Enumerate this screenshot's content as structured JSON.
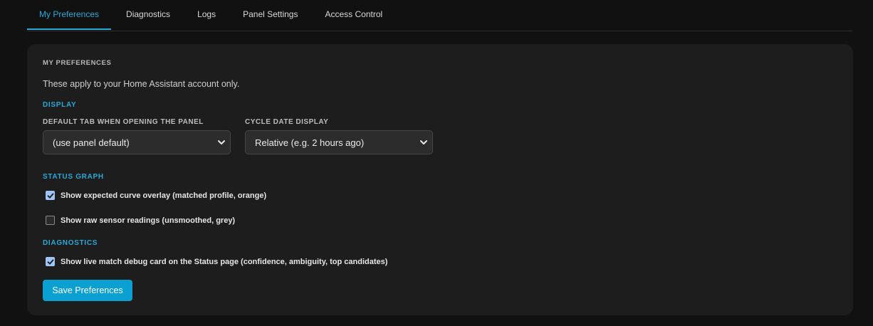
{
  "tabs": [
    {
      "label": "My Preferences",
      "active": true
    },
    {
      "label": "Diagnostics",
      "active": false
    },
    {
      "label": "Logs",
      "active": false
    },
    {
      "label": "Panel Settings",
      "active": false
    },
    {
      "label": "Access Control",
      "active": false
    }
  ],
  "card": {
    "title": "MY PREFERENCES",
    "intro": "These apply to your Home Assistant account only."
  },
  "display": {
    "heading": "DISPLAY",
    "default_tab": {
      "label": "DEFAULT TAB WHEN OPENING THE PANEL",
      "value": "(use panel default)"
    },
    "cycle_date": {
      "label": "CYCLE DATE DISPLAY",
      "value": "Relative (e.g. 2 hours ago)"
    }
  },
  "status_graph": {
    "heading": "STATUS GRAPH",
    "options": [
      {
        "label": "Show expected curve overlay (matched profile, orange)",
        "checked": true
      },
      {
        "label": "Show raw sensor readings (unsmoothed, grey)",
        "checked": false
      }
    ]
  },
  "diagnostics": {
    "heading": "DIAGNOSTICS",
    "options": [
      {
        "label": "Show live match debug card on the Status page (confidence, ambiguity, top candidates)",
        "checked": true
      }
    ]
  },
  "actions": {
    "save_label": "Save Preferences"
  },
  "colors": {
    "accent": "#2aa8d8",
    "button": "#0ba0d2",
    "checkbox_checked": "#9ec5f5",
    "card_bg": "#1d1d1d",
    "page_bg": "#111111"
  },
  "icons": {
    "select_arrow": "chevron-down-icon",
    "check": "checkmark-icon"
  }
}
